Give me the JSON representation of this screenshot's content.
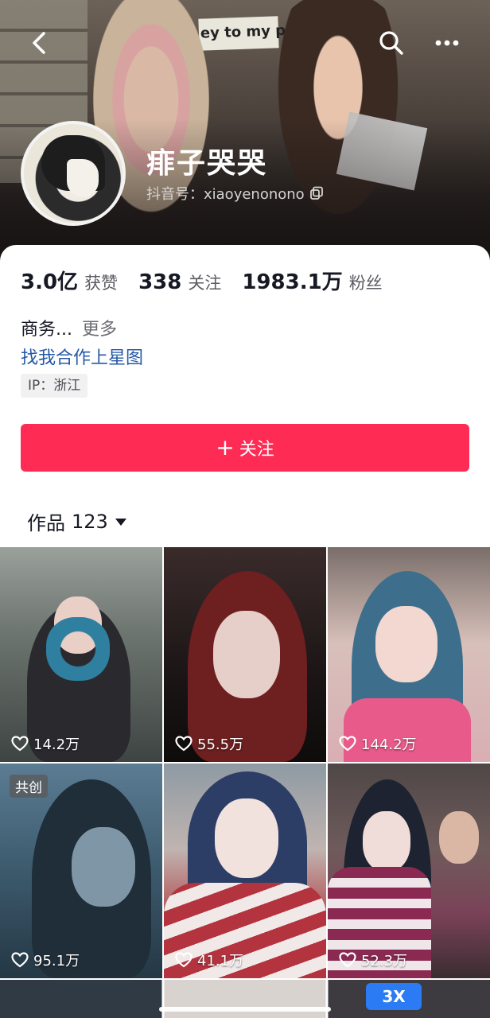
{
  "profile": {
    "nickname": "痱子哭哭",
    "douyin_id": "抖音号：xiaoyenonono"
  },
  "stats": [
    {
      "value": "3.0亿",
      "label": "获赞"
    },
    {
      "value": "338",
      "label": "关注"
    },
    {
      "value": "1983.1万",
      "label": "粉丝"
    }
  ],
  "bio": {
    "text": "商务...",
    "more": "更多",
    "link": "找我合作上星图",
    "ip": "IP：浙江"
  },
  "follow_button": {
    "plus": "+",
    "label": "关注"
  },
  "works": {
    "label": "作品",
    "count": "123"
  },
  "videos": [
    {
      "likes": "14.2万",
      "badge": ""
    },
    {
      "likes": "55.5万",
      "badge": ""
    },
    {
      "likes": "144.2万",
      "badge": ""
    },
    {
      "likes": "95.1万",
      "badge": "共创"
    },
    {
      "likes": "41.1万",
      "badge": ""
    },
    {
      "likes": "52.3万",
      "badge": ""
    }
  ],
  "watermark": "3X"
}
